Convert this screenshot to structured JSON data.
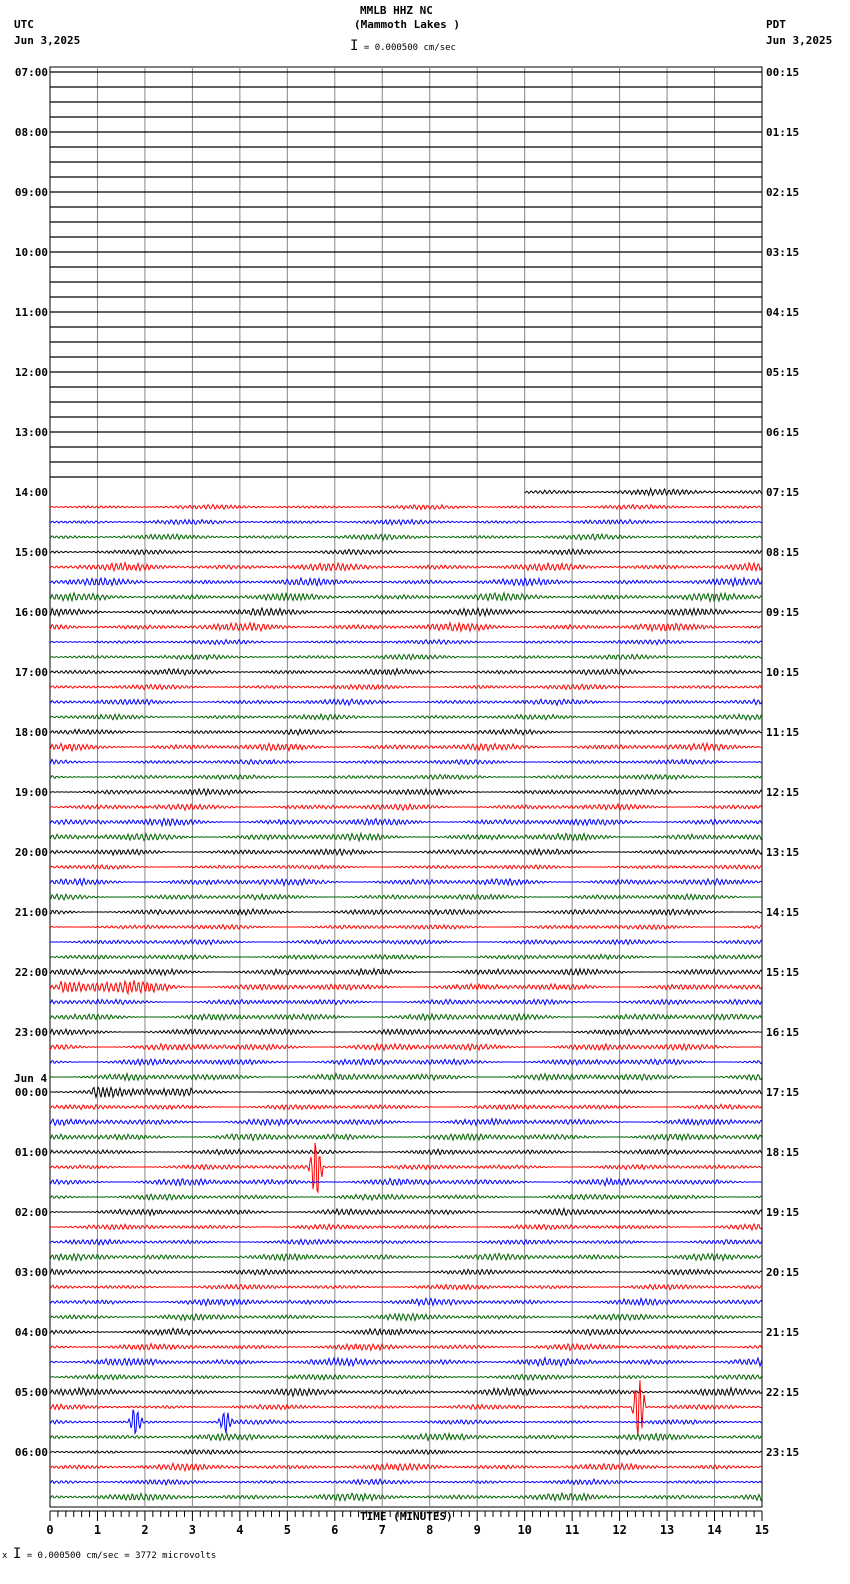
{
  "header": {
    "title": "MMLB HHZ NC",
    "subtitle": "(Mammoth Lakes )",
    "left_tz": "UTC",
    "left_date": "Jun 3,2025",
    "right_tz": "PDT",
    "right_date": "Jun 3,2025",
    "scale": "= 0.000500 cm/sec"
  },
  "footer": {
    "scale": "= 0.000500 cm/sec =    3772 microvolts",
    "prefix": "x"
  },
  "chart_data": {
    "type": "line",
    "title": "MMLB HHZ NC (Mammoth Lakes )",
    "xlabel": "TIME (MINUTES)",
    "xlim": [
      0,
      15
    ],
    "x_ticks": [
      "0",
      "1",
      "2",
      "3",
      "4",
      "5",
      "6",
      "7",
      "8",
      "9",
      "10",
      "11",
      "12",
      "13",
      "14",
      "15"
    ],
    "rows_per_hour": 4,
    "left_hour_labels": [
      "07:00",
      "08:00",
      "09:00",
      "10:00",
      "11:00",
      "12:00",
      "13:00",
      "14:00",
      "15:00",
      "16:00",
      "17:00",
      "18:00",
      "19:00",
      "20:00",
      "21:00",
      "22:00",
      "23:00",
      "00:00",
      "01:00",
      "02:00",
      "03:00",
      "04:00",
      "05:00",
      "06:00"
    ],
    "date_change_label": "Jun 4",
    "right_hour_labels": [
      "00:15",
      "01:15",
      "02:15",
      "03:15",
      "04:15",
      "05:15",
      "06:15",
      "07:15",
      "08:15",
      "09:15",
      "10:15",
      "11:15",
      "12:15",
      "13:15",
      "14:15",
      "15:15",
      "16:15",
      "17:15",
      "18:15",
      "19:15",
      "20:15",
      "21:15",
      "22:15",
      "23:15"
    ],
    "trace_colors": [
      "#000000",
      "#ff0000",
      "#0000ff",
      "#006400"
    ],
    "data_start": {
      "row_label": "14:00",
      "minute": 10
    },
    "events": [
      {
        "time": "22:15",
        "start_min": 0.2,
        "end_min": 3.3,
        "amplitude": 2.2
      },
      {
        "time": "00:00",
        "start_min": 0.9,
        "end_min": 3.0,
        "amplitude": 2.5
      },
      {
        "time": "01:15",
        "spike_min": 5.6,
        "amplitude": 6
      },
      {
        "time": "05:15",
        "spike_min": 12.4,
        "amplitude": 6
      },
      {
        "time": "05:30",
        "spike_min": 1.8,
        "amplitude": 3
      },
      {
        "time": "05:30",
        "spike_min": 3.7,
        "amplitude": 2
      }
    ]
  }
}
